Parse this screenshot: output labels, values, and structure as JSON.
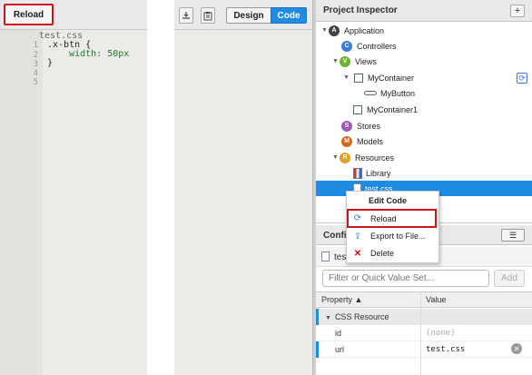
{
  "toolbar_left": {
    "reload_label": "Reload"
  },
  "editor": {
    "file_name": "test.css",
    "line_numbers": [
      "1",
      "2",
      "3",
      "4",
      "5"
    ],
    "lines": [
      ".x-btn {",
      "    width: 50px",
      "}",
      "",
      ""
    ]
  },
  "toolbar_mid": {
    "design_label": "Design",
    "code_label": "Code",
    "accent": "#1f8be3"
  },
  "inspector": {
    "title": "Project Inspector",
    "add_label": "+",
    "tree": {
      "application": "Application",
      "controllers": "Controllers",
      "views": "Views",
      "my_container": "MyContainer",
      "my_button": "MyButton",
      "my_container1": "MyContainer1",
      "stores": "Stores",
      "models": "Models",
      "resources": "Resources",
      "library": "Library",
      "selected_file": "test.css"
    }
  },
  "context_menu": {
    "title": "Edit Code",
    "items": {
      "reload": "Reload",
      "export": "Export to File...",
      "delete": "Delete"
    }
  },
  "config": {
    "title": "Confi",
    "file_label": "test",
    "filter_placeholder": "Filter or Quick Value Set...",
    "add_label": "Add",
    "col_property": "Property ▲",
    "col_value": "Value",
    "group_label": "CSS Resource",
    "props": {
      "id_name": "id",
      "id_value": "(none)",
      "url_name": "url",
      "url_value": "test.css"
    }
  }
}
